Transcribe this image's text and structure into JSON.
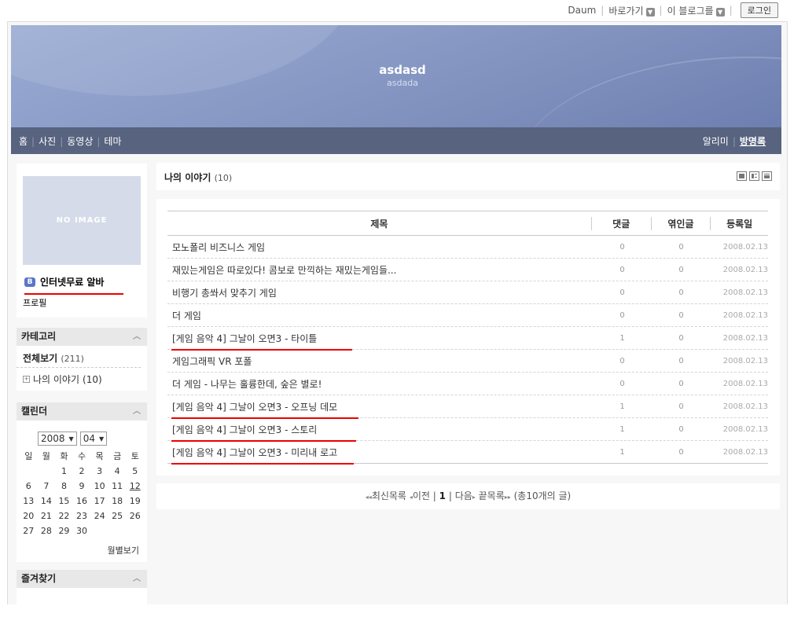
{
  "topbar": {
    "daum": "Daum",
    "goto": "바로가기",
    "this_blog": "이 블로그를",
    "login": "로그인"
  },
  "banner": {
    "title": "asdasd",
    "subtitle": "asdada"
  },
  "nav": {
    "left": [
      "홈",
      "사진",
      "동영상",
      "테마"
    ],
    "right": [
      "알리미",
      "방명록"
    ]
  },
  "profile": {
    "no_image": "NO IMAGE",
    "name": "인터넷무료 알바",
    "profile_link": "프로필"
  },
  "category": {
    "title": "카테고리",
    "all_label": "전체보기",
    "all_count": "(211)",
    "items": [
      {
        "label": "나의 이야기",
        "count": "(10)"
      }
    ]
  },
  "calendar": {
    "title": "캘린더",
    "year": "2008",
    "month": "04",
    "weekdays": [
      "일",
      "월",
      "화",
      "수",
      "목",
      "금",
      "토"
    ],
    "weeks": [
      [
        "",
        "",
        "1",
        "2",
        "3",
        "4",
        "5"
      ],
      [
        "6",
        "7",
        "8",
        "9",
        "10",
        "11",
        "12"
      ],
      [
        "13",
        "14",
        "15",
        "16",
        "17",
        "18",
        "19"
      ],
      [
        "20",
        "21",
        "22",
        "23",
        "24",
        "25",
        "26"
      ],
      [
        "27",
        "28",
        "29",
        "30",
        "",
        "",
        ""
      ]
    ],
    "linked_day": "12",
    "monthly_view": "월별보기"
  },
  "favorites": {
    "title": "즐겨찾기"
  },
  "content": {
    "title": "나의 이야기",
    "count": "(10)",
    "headers": {
      "title": "제목",
      "comments": "댓글",
      "trackbacks": "엮인글",
      "date": "등록일"
    },
    "rows": [
      {
        "title": "모노폴리 비즈니스 게임",
        "comments": "0",
        "trackbacks": "0",
        "date": "2008.02.13",
        "underline": false
      },
      {
        "title": "재밌는게임은 따로있다! 콤보로 만끽하는 재밌는게임들...",
        "comments": "0",
        "trackbacks": "0",
        "date": "2008.02.13",
        "underline": false
      },
      {
        "title": "비행기 총쏴서 맞추기 게임",
        "comments": "0",
        "trackbacks": "0",
        "date": "2008.02.13",
        "underline": false
      },
      {
        "title": "더 게임",
        "comments": "0",
        "trackbacks": "0",
        "date": "2008.02.13",
        "underline": false
      },
      {
        "title": "[게임 음악 4] 그날이 오면3 - 타이틀",
        "comments": "1",
        "trackbacks": "0",
        "date": "2008.02.13",
        "underline": true
      },
      {
        "title": "게임그래픽 VR 포폴",
        "comments": "0",
        "trackbacks": "0",
        "date": "2008.02.13",
        "underline": false
      },
      {
        "title": "더 게임 - 나무는 훌륭한데, 숲은 별로!",
        "comments": "0",
        "trackbacks": "0",
        "date": "2008.02.13",
        "underline": false
      },
      {
        "title": "[게임 음악 4] 그날이 오면3 - 오프닝 데모",
        "comments": "1",
        "trackbacks": "0",
        "date": "2008.02.13",
        "underline": true
      },
      {
        "title": "[게임 음악 4] 그날이 오면3 - 스토리",
        "comments": "1",
        "trackbacks": "0",
        "date": "2008.02.13",
        "underline": true
      },
      {
        "title": "[게임 음악 4] 그날이 오면3 - 미리내 로고",
        "comments": "1",
        "trackbacks": "0",
        "date": "2008.02.13",
        "underline": true
      }
    ]
  },
  "pager": {
    "latest": "최신목록",
    "prev": "이전",
    "page": "1",
    "next": "다음",
    "last": "끝목록",
    "total": "(총10개의 글)"
  },
  "colors": {
    "nav_bg": "#57637f",
    "banner": "#8c9dc8",
    "annotation_red": "#e00000"
  }
}
